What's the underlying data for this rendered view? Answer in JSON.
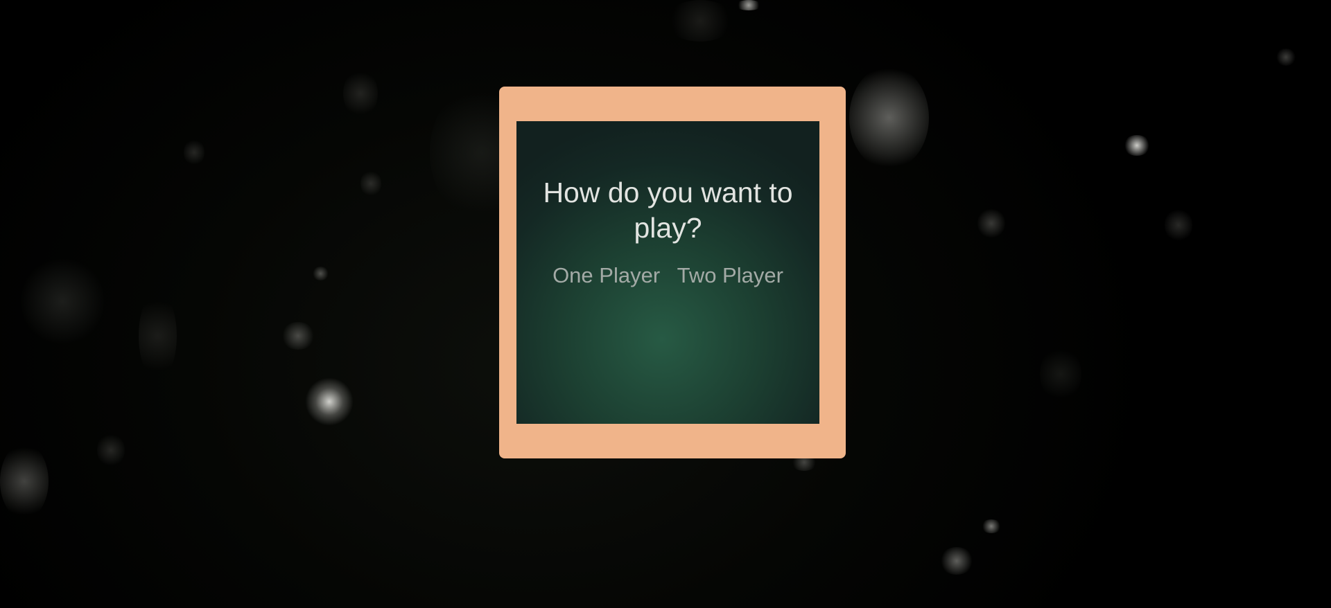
{
  "game": {
    "mode_select": {
      "prompt": "How do you want to play?",
      "options": [
        {
          "label": "One Player"
        },
        {
          "label": "Two Player"
        }
      ]
    }
  },
  "colors": {
    "frame": "#f0b48a",
    "panel_center": "#275a44",
    "panel_edge": "#12211f",
    "prompt_text": "#e2e4e1",
    "option_text": "#a3aaa6",
    "background": "#000000"
  }
}
